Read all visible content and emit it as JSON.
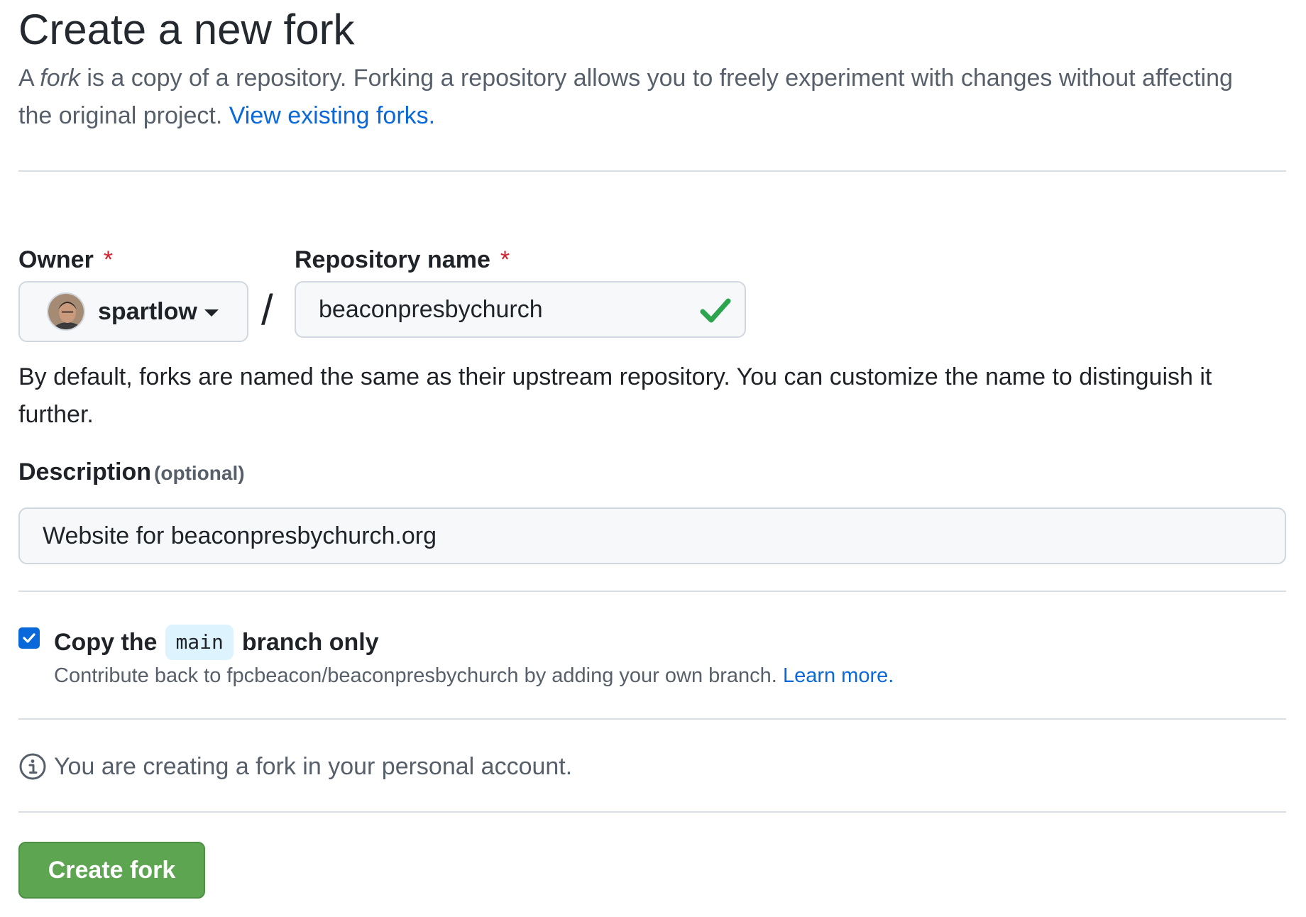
{
  "header": {
    "title": "Create a new fork",
    "intro_prefix": "A ",
    "intro_em": "fork",
    "intro_rest": " is a copy of a repository. Forking a repository allows you to freely experiment with changes without affecting the original project. ",
    "view_forks_link": "View existing forks."
  },
  "form": {
    "owner_label": "Owner",
    "repo_label": "Repository name",
    "required_mark": "*",
    "owner_value": "spartlow",
    "separator": "/",
    "repo_value": "beaconpresbychurch",
    "name_help": "By default, forks are named the same as their upstream repository. You can customize the name to distinguish it further.",
    "description_label": "Description",
    "description_optional": "(optional)",
    "description_value": "Website for beaconpresbychurch.org"
  },
  "copy_branch": {
    "checked": true,
    "label_prefix": "Copy the",
    "branch": "main",
    "label_suffix": "branch only",
    "sub_text": "Contribute back to fpcbeacon/beaconpresbychurch by adding your own branch. ",
    "learn_more": "Learn more."
  },
  "notice": {
    "text": "You are creating a fork in your personal account."
  },
  "actions": {
    "create_fork": "Create fork"
  },
  "colors": {
    "link": "#0969da",
    "required": "#cf222e",
    "success": "#5ea552",
    "check": "#2da44e"
  }
}
